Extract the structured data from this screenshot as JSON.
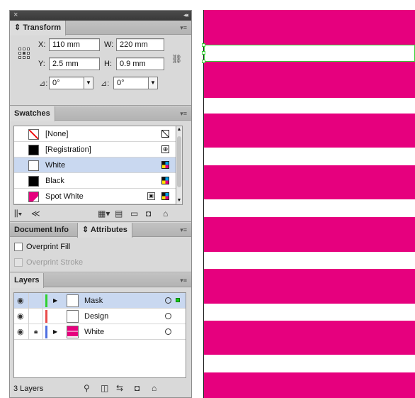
{
  "window": {
    "close_glyph": "×",
    "collapse_glyph": "◂◂"
  },
  "transform": {
    "tab": "Transform",
    "x_label": "X:",
    "x_value": "110 mm",
    "y_label": "Y:",
    "y_value": "2.5 mm",
    "w_label": "W:",
    "w_value": "220 mm",
    "h_label": "H:",
    "h_value": "0.9 mm",
    "rotate_value": "0°",
    "shear_value": "0°",
    "menu_icon": "panel-menu-icon"
  },
  "swatches": {
    "tab": "Swatches",
    "items": [
      {
        "name": "[None]",
        "color": "none"
      },
      {
        "name": "[Registration]",
        "color": "#000000"
      },
      {
        "name": "White",
        "color": "#ffffff",
        "selected": true
      },
      {
        "name": "Black",
        "color": "#000000"
      },
      {
        "name": "Spot White",
        "color": "#e6007e"
      }
    ]
  },
  "attributes": {
    "tab_document_info": "Document Info",
    "tab_attributes": "Attributes",
    "overprint_fill": "Overprint Fill",
    "overprint_stroke": "Overprint Stroke"
  },
  "layers": {
    "tab": "Layers",
    "items": [
      {
        "name": "Mask",
        "color": "#2fd12f",
        "thumb": "#ffffff",
        "locked": false,
        "expandable": true,
        "selected": true
      },
      {
        "name": "Design",
        "color": "#e84b4b",
        "thumb": "#ffffff",
        "locked": false,
        "expandable": false,
        "selected": false
      },
      {
        "name": "White",
        "color": "#4f6fe0",
        "thumb": "#e6007e",
        "locked": true,
        "expandable": true,
        "selected": false
      }
    ],
    "count_label": "3 Layers"
  },
  "canvas": {
    "stripe_color": "#e6007e",
    "selection_color": "#35d135"
  }
}
